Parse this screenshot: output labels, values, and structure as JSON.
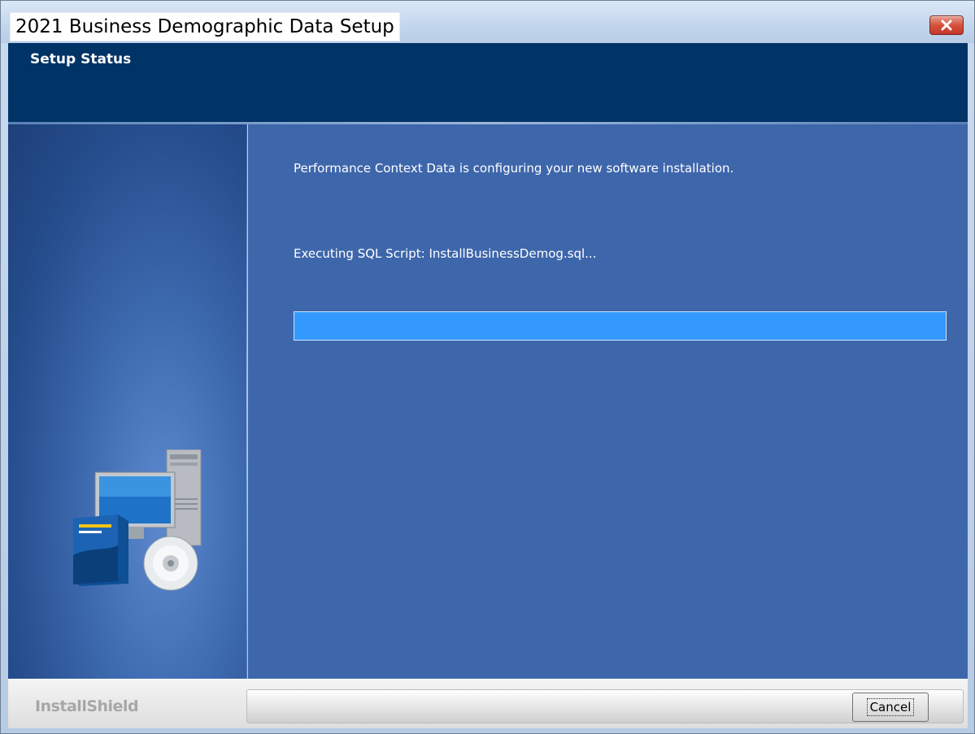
{
  "window": {
    "title": "2021 Business Demographic Data Setup"
  },
  "header": {
    "title": "Setup Status"
  },
  "main": {
    "status_message": "Performance Context Data is configuring your new software installation.",
    "action_message": "Executing SQL Script: InstallBusinessDemog.sql...",
    "progress_fraction": 1.0
  },
  "footer": {
    "brand": "InstallShield",
    "cancel_label": "Cancel"
  },
  "icons": {
    "close": "close-icon",
    "illustration": "computer-with-disc-icon"
  },
  "colors": {
    "header_band": "#003366",
    "main_panel": "#3e66ab",
    "progress_fill": "#3399ff"
  }
}
